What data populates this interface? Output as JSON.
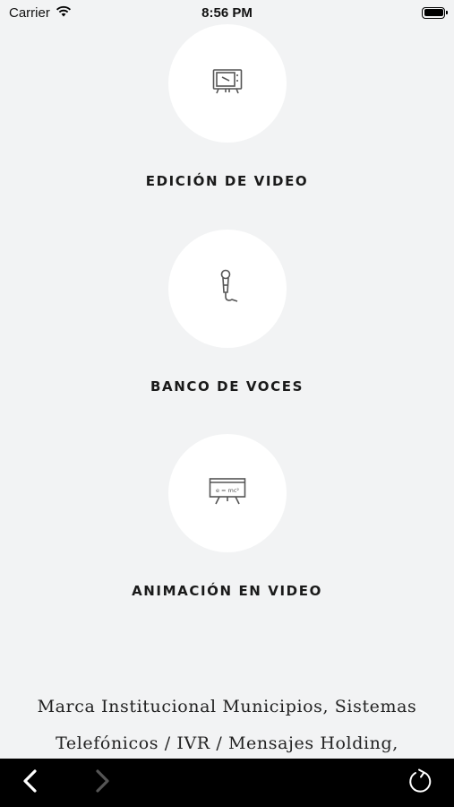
{
  "status_bar": {
    "carrier": "Carrier",
    "time": "8:56 PM"
  },
  "services": [
    {
      "title": "EDICIÓN DE VIDEO",
      "icon": "tv-icon"
    },
    {
      "title": "BANCO DE VOCES",
      "icon": "microphone-icon"
    },
    {
      "title": "ANIMACIÓN EN VIDEO",
      "icon": "whiteboard-icon",
      "icon_text": "e = mc²"
    }
  ],
  "description": "Marca Institucional Municipios, Sistemas Telefónicos / IVR / Mensajes Holding,",
  "toolbar": {
    "back_icon": "chevron-left-icon",
    "forward_icon": "chevron-right-icon",
    "reload_icon": "reload-icon"
  },
  "colors": {
    "background": "#f2f3f4",
    "circle": "#ffffff",
    "toolbar": "#000000",
    "icon": "#555555"
  }
}
